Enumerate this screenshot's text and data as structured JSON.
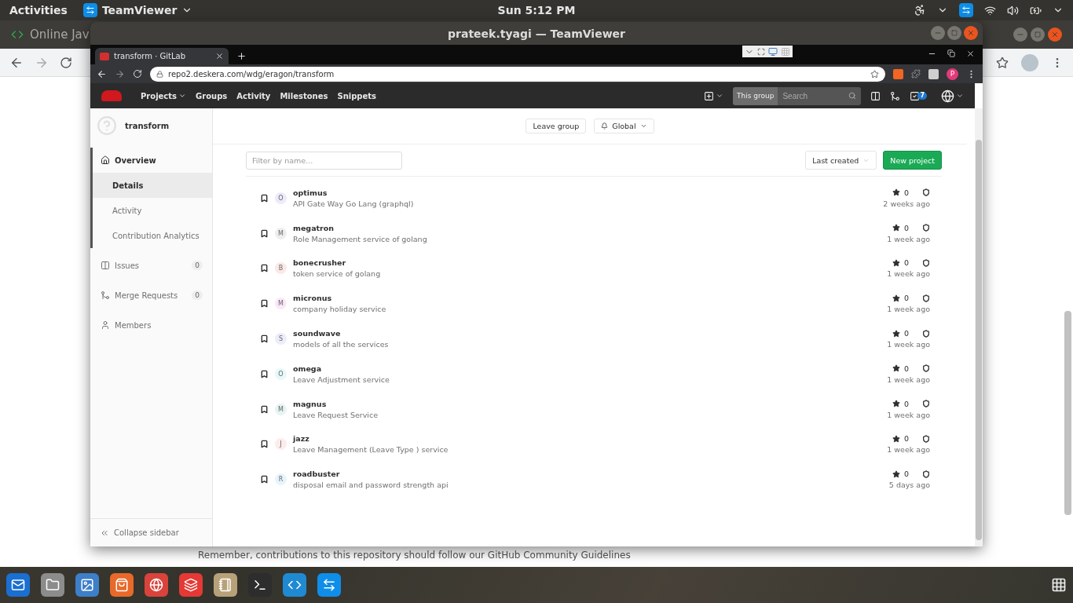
{
  "top_bar": {
    "activities": "Activities",
    "app": "TeamViewer",
    "clock": "Sun  5:12 PM"
  },
  "background_browser": {
    "tab": "Online Jav",
    "note": "Remember, contributions to this repository should follow our GitHub Community Guidelines"
  },
  "teamviewer": {
    "title": "prateek.tyagi — TeamViewer"
  },
  "browser": {
    "tab": "transform · GitLab",
    "url": "repo2.deskera.com/wdg/eragon/transform",
    "profile": "P"
  },
  "gitlab_nav": {
    "items": [
      {
        "label": "Projects",
        "dropdown": true
      },
      {
        "label": "Groups",
        "dropdown": false
      },
      {
        "label": "Activity",
        "dropdown": false
      },
      {
        "label": "Milestones",
        "dropdown": false
      },
      {
        "label": "Snippets",
        "dropdown": false
      }
    ],
    "scope": "This group",
    "search_placeholder": "Search",
    "todo_count": "7"
  },
  "sidebar": {
    "group": "transform",
    "items": [
      {
        "label": "Overview",
        "kind": "overview",
        "selected": true,
        "children": [
          {
            "label": "Details",
            "selected": true
          },
          {
            "label": "Activity",
            "selected": false
          },
          {
            "label": "Contribution Analytics",
            "selected": false
          }
        ]
      },
      {
        "label": "Issues",
        "kind": "issues",
        "selected": false,
        "count": "0"
      },
      {
        "label": "Merge Requests",
        "kind": "merge",
        "selected": false,
        "count": "0"
      },
      {
        "label": "Members",
        "kind": "members",
        "selected": false
      }
    ],
    "collapse": "Collapse sidebar"
  },
  "group_actions": {
    "leave": "Leave group",
    "notification": "Global"
  },
  "filter": {
    "placeholder": "Filter by name..."
  },
  "sort": "Last created",
  "new_project": "New project",
  "projects": [
    {
      "name": "optimus",
      "description": "API Gate Way Go Lang (graphql)",
      "initial": "O",
      "color": "#ebebfb",
      "star_count": "0",
      "updated": "2 weeks ago"
    },
    {
      "name": "megatron",
      "description": "Role Management service of golang",
      "initial": "M",
      "color": "#eeeeee",
      "star_count": "0",
      "updated": "1 week ago"
    },
    {
      "name": "bonecrusher",
      "description": "token service of golang",
      "initial": "B",
      "color": "#fbe9e7",
      "star_count": "0",
      "updated": "1 week ago"
    },
    {
      "name": "micronus",
      "description": "company holiday service",
      "initial": "M",
      "color": "#fbe8f7",
      "star_count": "0",
      "updated": "1 week ago"
    },
    {
      "name": "soundwave",
      "description": "models of all the services",
      "initial": "S",
      "color": "#ececfa",
      "star_count": "0",
      "updated": "1 week ago"
    },
    {
      "name": "omega",
      "description": "Leave Adjustment service",
      "initial": "O",
      "color": "#e6f8fa",
      "star_count": "0",
      "updated": "1 week ago"
    },
    {
      "name": "magnus",
      "description": "Leave Request Service",
      "initial": "M",
      "color": "#e6f5f1",
      "star_count": "0",
      "updated": "1 week ago"
    },
    {
      "name": "jazz",
      "description": "Leave Management (Leave Type ) service",
      "initial": "J",
      "color": "#fdecec",
      "star_count": "0",
      "updated": "1 week ago"
    },
    {
      "name": "roadbuster",
      "description": "disposal email and password strength api",
      "initial": "R",
      "color": "#e6f5fb",
      "star_count": "0",
      "updated": "5 days ago"
    }
  ]
}
